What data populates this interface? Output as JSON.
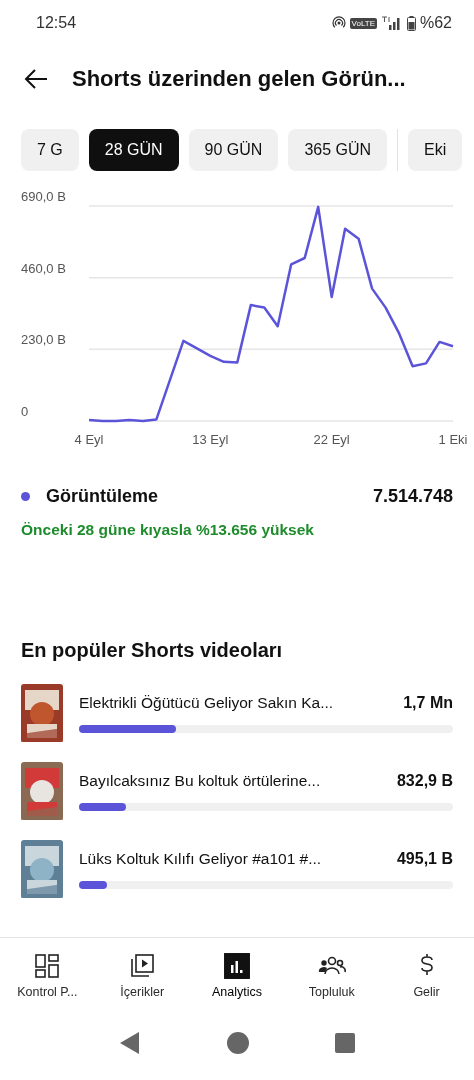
{
  "status_bar": {
    "time": "12:54",
    "network": "VoLTE",
    "battery": "%62"
  },
  "header": {
    "title": "Shorts üzerinden gelen Görün..."
  },
  "ranges": [
    {
      "label": "7 G",
      "selected": false
    },
    {
      "label": "28 GÜN",
      "selected": true
    },
    {
      "label": "90 GÜN",
      "selected": false
    },
    {
      "label": "365 GÜN",
      "selected": false
    },
    {
      "label": "Eki",
      "selected": false
    }
  ],
  "chart": {
    "chart_data": {
      "type": "line",
      "categories": [
        "4 Eyl",
        null,
        null,
        null,
        null,
        null,
        null,
        null,
        null,
        "13 Eyl",
        null,
        null,
        null,
        null,
        null,
        null,
        null,
        null,
        "22 Eyl",
        null,
        null,
        null,
        null,
        null,
        null,
        null,
        null,
        "1 Eki"
      ],
      "ylim": [
        0,
        690
      ],
      "yticks": [
        {
          "value": 0,
          "label": "0"
        },
        {
          "value": 230,
          "label": "230,0 B"
        },
        {
          "value": 460,
          "label": "460,0 B"
        },
        {
          "value": 690,
          "label": "690,0 B"
        }
      ],
      "series": [
        {
          "color": "#5b54d8",
          "values": [
            3,
            0,
            0,
            3,
            0,
            5,
            131,
            257,
            233,
            209,
            190,
            188,
            372,
            364,
            304,
            503,
            523,
            687,
            398,
            617,
            585,
            425,
            364,
            281,
            176,
            185,
            254,
            240
          ]
        }
      ]
    }
  },
  "metric": {
    "label": "Görüntüleme",
    "color": "#5b54d8",
    "value": "7.514.748",
    "comparison": "Önceki 28 güne kıyasla %13.656 yüksek"
  },
  "top_videos": {
    "title": "En popüler Shorts videoları",
    "items": [
      {
        "title": "Elektrikli Öğütücü Geliyor Sakın Ka...",
        "views": "1,7 Mn",
        "level": 0.26
      },
      {
        "title": "Bayılcaksınız Bu koltuk  örtülerine...",
        "views": "832,9 B",
        "level": 0.126
      },
      {
        "title": "Lüks Koltuk Kılıfı Geliyor #a101 #...",
        "views": "495,1 B",
        "level": 0.075
      }
    ]
  },
  "bottom_nav": [
    {
      "label": "Kontrol P...",
      "selected": false
    },
    {
      "label": "İçerikler",
      "selected": false
    },
    {
      "label": "Analytics",
      "selected": true
    },
    {
      "label": "Topluluk",
      "selected": false
    },
    {
      "label": "Gelir",
      "selected": false
    }
  ]
}
